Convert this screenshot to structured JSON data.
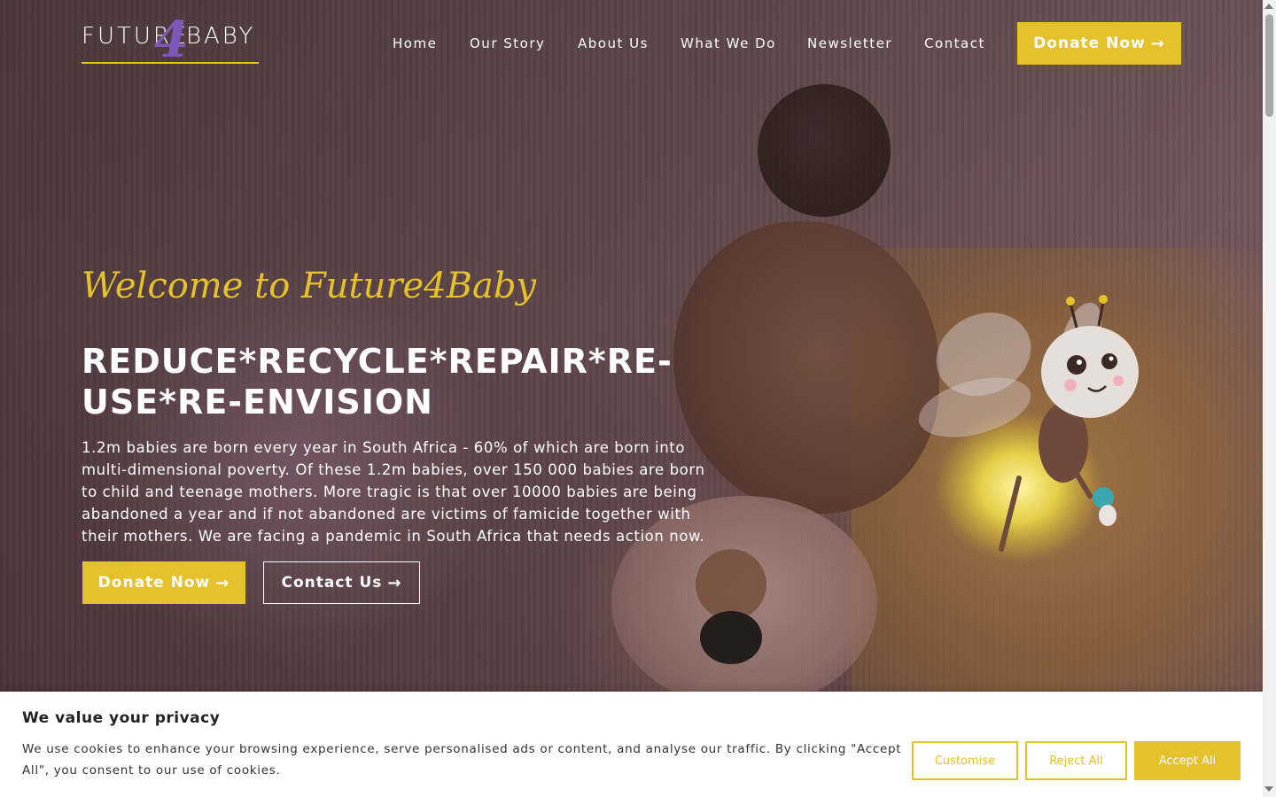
{
  "brand": {
    "logo_left": "FUTURE",
    "logo_number": "4",
    "logo_right": "BABY"
  },
  "nav": {
    "items": [
      {
        "label": "Home"
      },
      {
        "label": "Our Story"
      },
      {
        "label": "About Us"
      },
      {
        "label": "What We Do"
      },
      {
        "label": "Newsletter"
      },
      {
        "label": "Contact"
      }
    ],
    "donate_label": "Donate Now"
  },
  "hero": {
    "welcome": "Welcome to Future4Baby",
    "headline": "REDUCE*RECYCLE*REPAIR*RE-USE*RE-ENVISION",
    "intro": "1.2m babies are born every year in South Africa - 60% of which are born into multi-dimensional poverty. Of these 1.2m babies, over 150 000 babies are born to child and teenage mothers. More tragic is that over 10000 babies are being abandoned a year and if not abandoned are victims of famicide together with their mothers. We are facing a pandemic in South Africa that needs action now.",
    "donate_label": "Donate Now",
    "contact_label": "Contact Us"
  },
  "icons": {
    "arrow": "arrow-right-icon",
    "arrow_glyph": "→"
  },
  "cookie": {
    "title": "We value your privacy",
    "text": "We use cookies to enhance your browsing experience, serve personalised ads or content, and analyse our traffic. By clicking \"Accept All\", you consent to our use of cookies.",
    "customise_label": "Customise",
    "reject_label": "Reject All",
    "accept_label": "Accept All"
  },
  "colors": {
    "accent": "#e5c12b",
    "brand_purple": "#7e58b8",
    "text_light": "#ffffff"
  }
}
